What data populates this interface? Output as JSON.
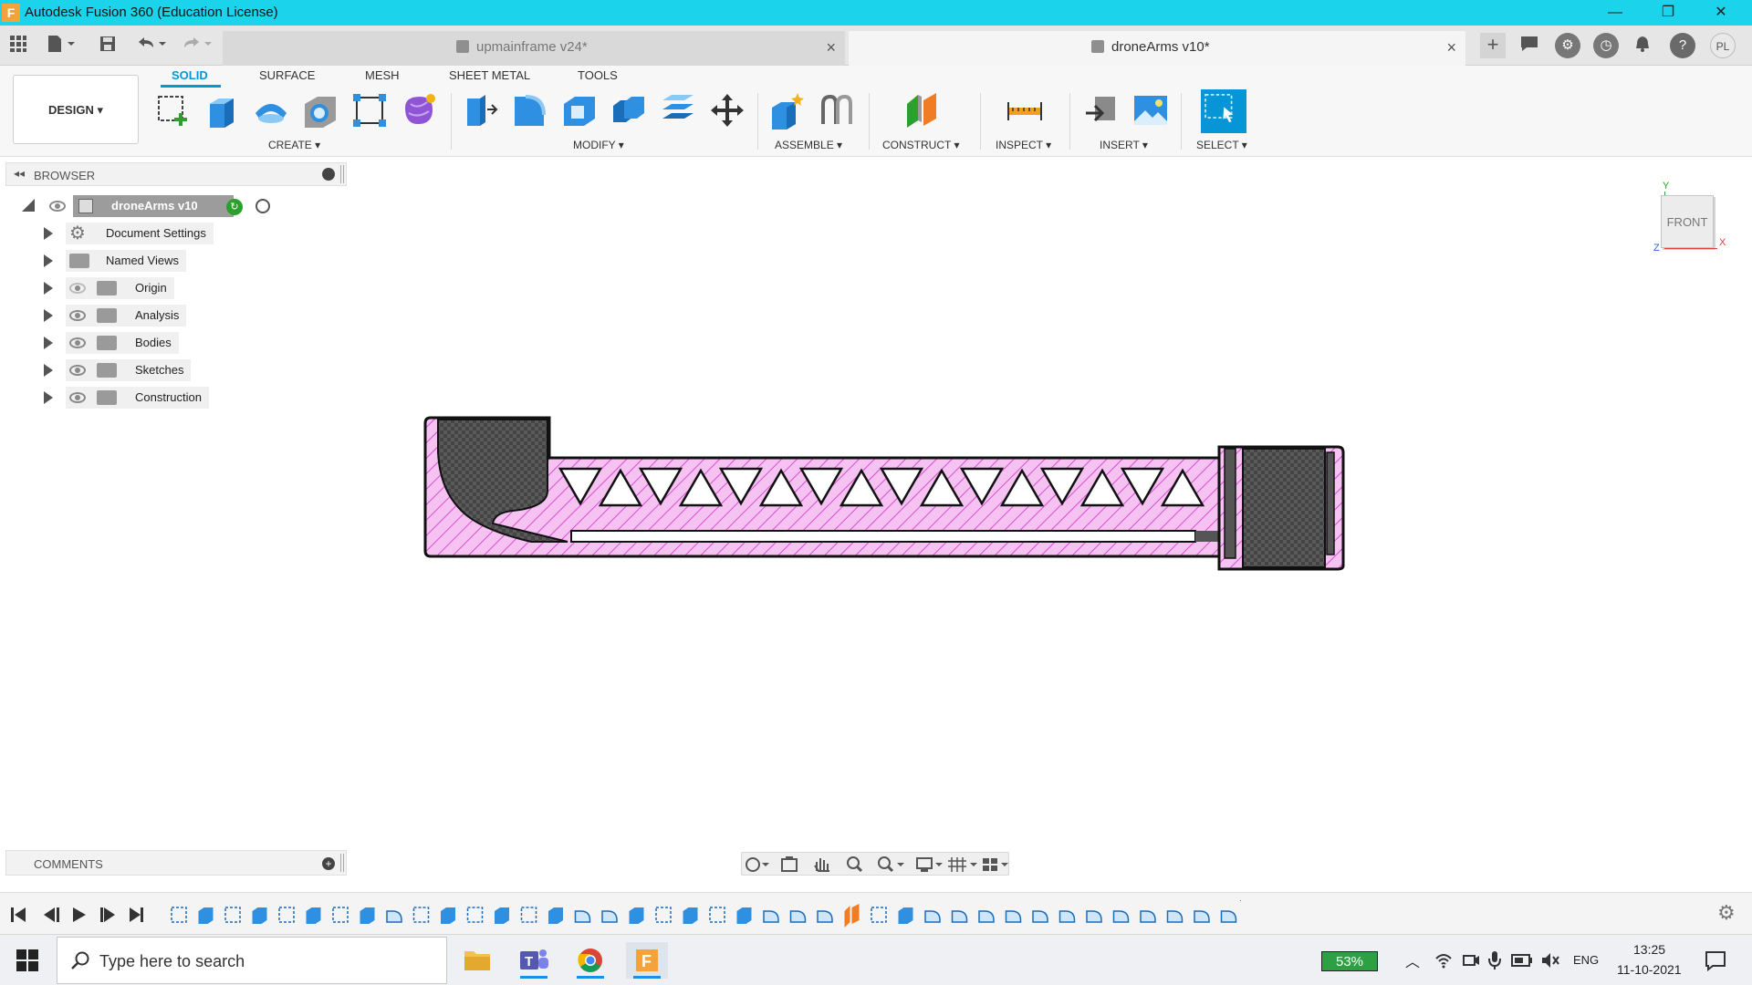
{
  "window": {
    "title": "Autodesk Fusion 360 (Education License)",
    "app_icon": "F",
    "controls": [
      "—",
      "❐",
      "✕"
    ]
  },
  "tabs": [
    {
      "label": "upmainframe v24*",
      "active": false
    },
    {
      "label": "droneArms v10*",
      "active": true
    }
  ],
  "user_initials": "PL",
  "ribbon": {
    "workspace": "DESIGN ▾",
    "tabs": [
      "SOLID",
      "SURFACE",
      "MESH",
      "SHEET METAL",
      "TOOLS"
    ],
    "groups": [
      "CREATE ▾",
      "MODIFY ▾",
      "ASSEMBLE ▾",
      "CONSTRUCT ▾",
      "INSPECT ▾",
      "INSERT ▾",
      "SELECT ▾"
    ]
  },
  "browser": {
    "title": "BROWSER",
    "root": "droneArms v10",
    "items": [
      "Document Settings",
      "Named Views",
      "Origin",
      "Analysis",
      "Bodies",
      "Sketches",
      "Construction"
    ]
  },
  "viewcube": {
    "face": "FRONT",
    "axis_y": "Y",
    "axis_x": "X",
    "axis_z": "Z"
  },
  "comments": {
    "title": "COMMENTS"
  },
  "taskbar": {
    "search_placeholder": "Type here to search",
    "battery": "53%",
    "language": "ENG",
    "time": "13:25",
    "date": "11-10-2021"
  },
  "colors": {
    "titlebar": "#1bd4ec",
    "accent": "#0696d7",
    "part_fill": "#f5c2f2",
    "hatch": "#e060d8"
  }
}
